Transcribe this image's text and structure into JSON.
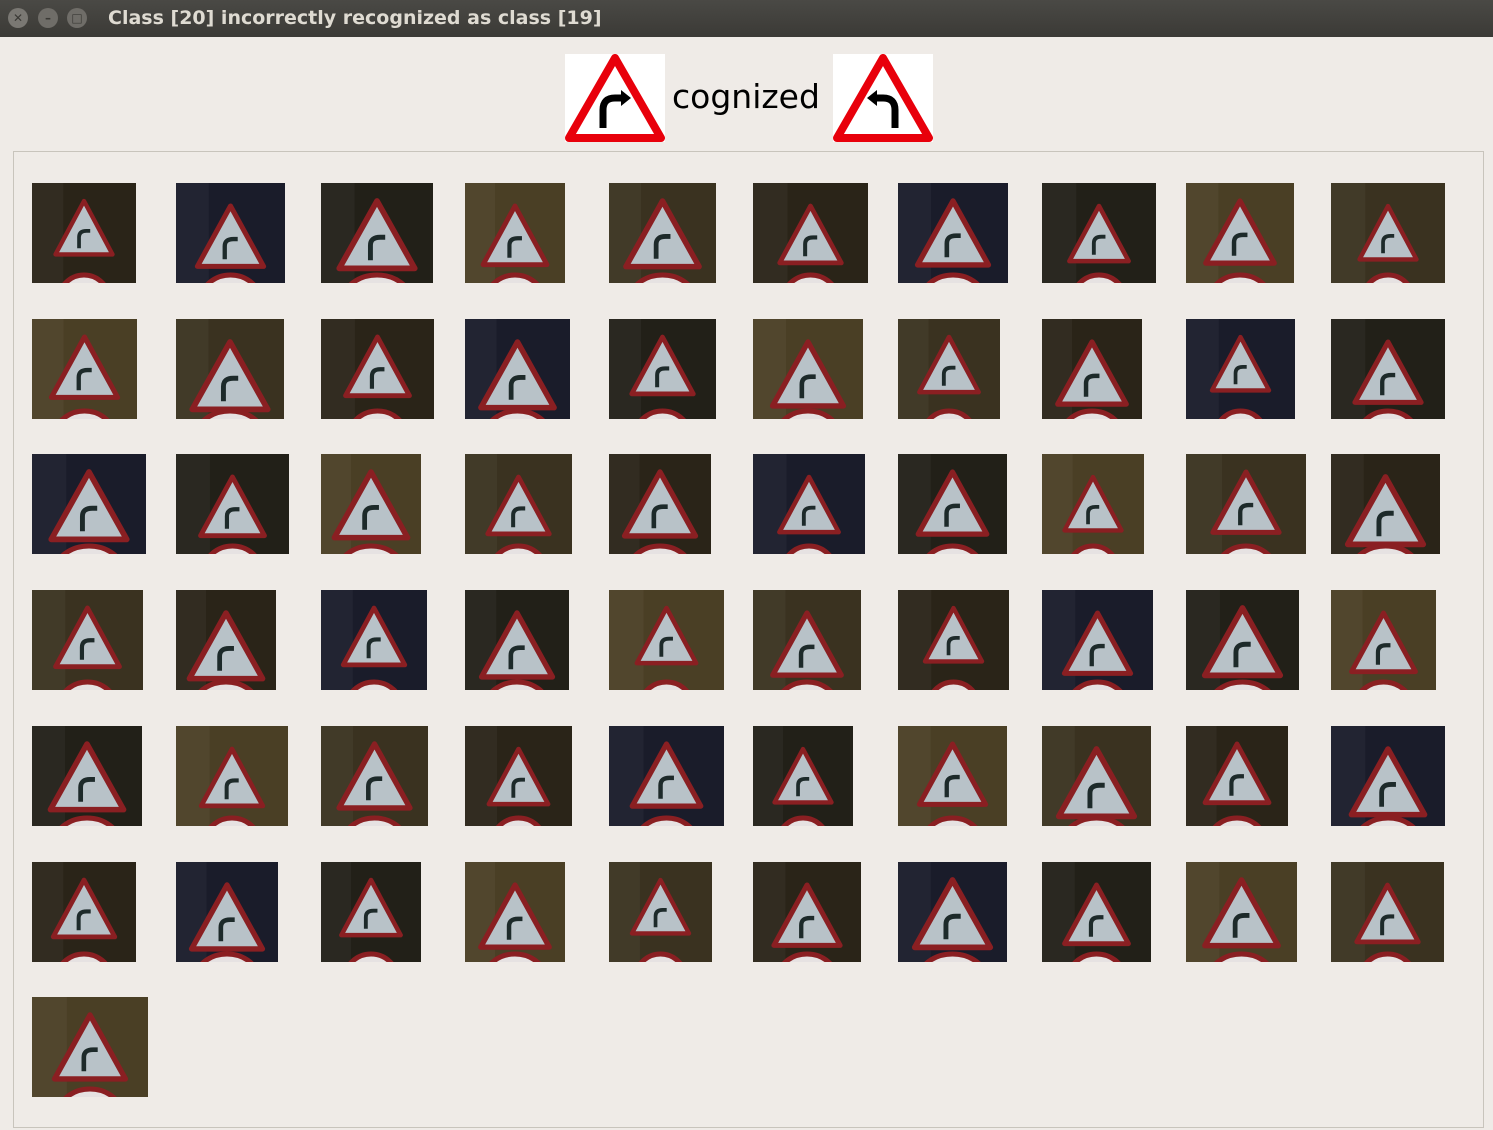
{
  "window": {
    "title": "Class [20] incorrectly recognized as class [19]",
    "close_glyph": "✕",
    "min_glyph": "–",
    "max_glyph": "□"
  },
  "header": {
    "label": "cognized",
    "true_class_icon": "curve-right-sign-icon",
    "predicted_class_icon": "curve-left-sign-icon"
  },
  "thumbnails": {
    "count": 61,
    "depicts": "dangerous-curve-right-sign-icon",
    "background_colors": [
      "#2a2418",
      "#4a3f25",
      "#1a1c2a",
      "#3a3220",
      "#222018"
    ]
  }
}
